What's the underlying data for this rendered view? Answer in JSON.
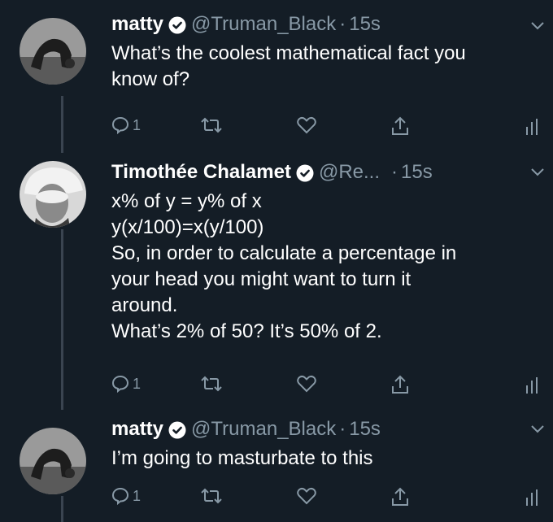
{
  "tweets": [
    {
      "name": "matty",
      "handle": "@Truman_Black",
      "separator": "·",
      "time": "15s",
      "lines": [
        "What’s the coolest mathematical fact you",
        "know of?"
      ],
      "reply_count": "1",
      "avatar": "person-doing-backbend-photo"
    },
    {
      "name": "Timothée Chalamet",
      "handle": "@Re...",
      "separator": "·",
      "time": "15s",
      "lines": [
        "x% of y = y% of x",
        "y(x/100)=x(y/100)",
        "So, in order to calculate a percentage in",
        "your head you might want to turn it",
        "around.",
        "What’s 2% of 50? It’s 50% of 2."
      ],
      "reply_count": "1",
      "avatar": "person-in-white-cap-photo"
    },
    {
      "name": "matty",
      "handle": "@Truman_Black",
      "separator": "·",
      "time": "15s",
      "lines": [
        "I’m going to masturbate to this"
      ],
      "reply_count": "1",
      "avatar": "person-doing-backbend-photo"
    }
  ],
  "icons": {
    "verified": "verified-badge-icon",
    "reply": "reply-icon",
    "retweet": "retweet-icon",
    "like": "heart-icon",
    "share": "share-icon",
    "analytics": "analytics-icon",
    "menu": "chevron-down-icon"
  },
  "colors": {
    "background": "#141d26",
    "text": "#ffffff",
    "secondary": "#8899a6",
    "thread_line": "#3a4450"
  }
}
